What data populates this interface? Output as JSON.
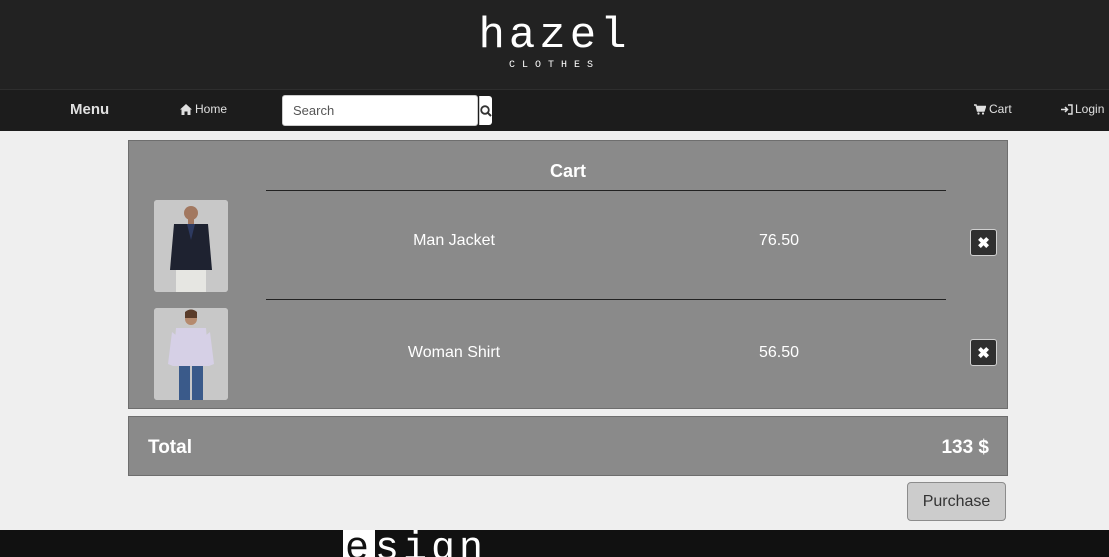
{
  "brand": {
    "name": "hazel",
    "subtitle": "CLOTHES"
  },
  "nav": {
    "menu_label": "Menu",
    "home_label": "Home",
    "search_placeholder": "Search",
    "cart_label": "Cart",
    "login_label": "Login"
  },
  "cart": {
    "title": "Cart",
    "items": [
      {
        "name": "Man Jacket",
        "price": "76.50",
        "image_icon": "jacket-photo"
      },
      {
        "name": "Woman Shirt",
        "price": "56.50",
        "image_icon": "shirt-photo"
      }
    ],
    "remove_icon": "close-icon"
  },
  "total": {
    "label": "Total",
    "value": "133 $"
  },
  "purchase_label": "Purchase",
  "footer": {
    "brand_first": "e",
    "brand_rest": "sign"
  },
  "colors": {
    "header_bg": "#222222",
    "panel_bg": "#8a8a8a",
    "page_bg": "#efefef"
  }
}
